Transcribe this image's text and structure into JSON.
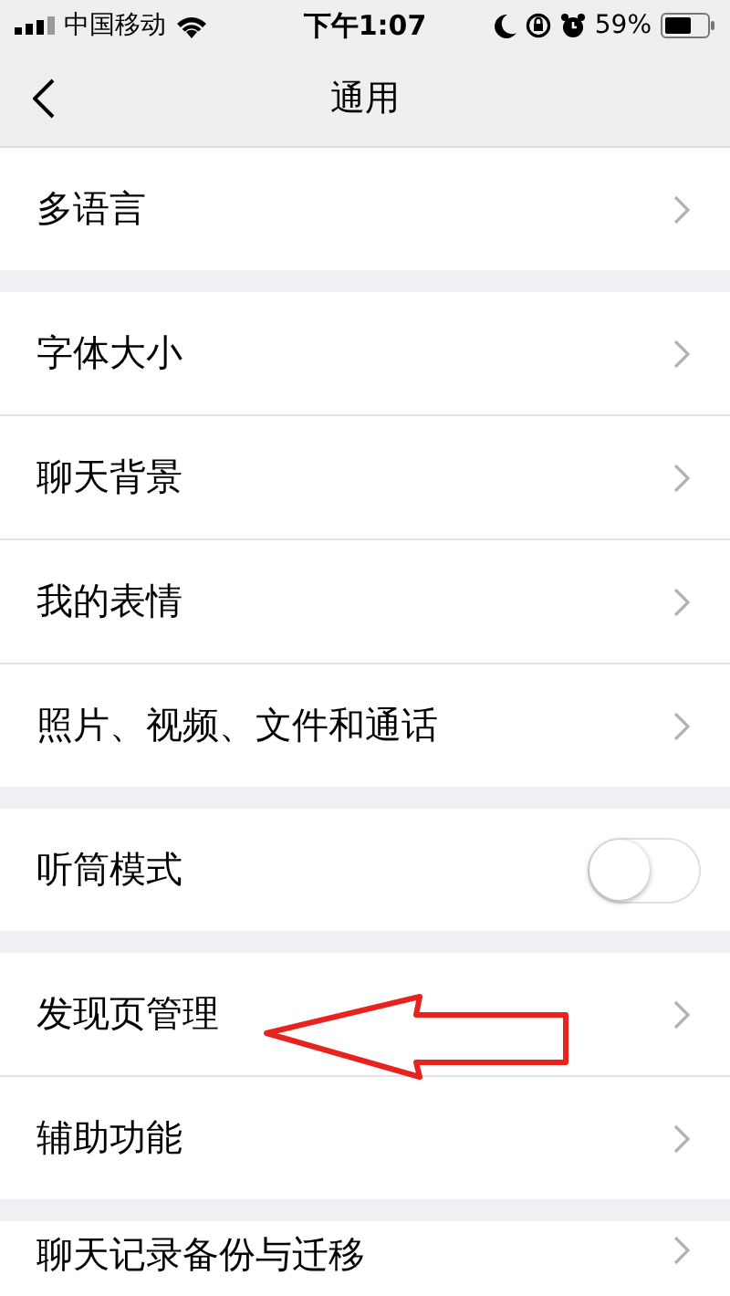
{
  "status_bar": {
    "carrier": "中国移动",
    "time": "下午1:07",
    "battery": "59%"
  },
  "nav": {
    "title": "通用"
  },
  "sections": [
    {
      "rows": [
        {
          "kind": "link",
          "label": "多语言"
        }
      ]
    },
    {
      "rows": [
        {
          "kind": "link",
          "label": "字体大小"
        },
        {
          "kind": "link",
          "label": "聊天背景"
        },
        {
          "kind": "link",
          "label": "我的表情"
        },
        {
          "kind": "link",
          "label": "照片、视频、文件和通话"
        }
      ]
    },
    {
      "rows": [
        {
          "kind": "toggle",
          "label": "听筒模式",
          "on": false
        }
      ]
    },
    {
      "rows": [
        {
          "kind": "link",
          "label": "发现页管理"
        },
        {
          "kind": "link",
          "label": "辅助功能"
        }
      ]
    },
    {
      "rows": [
        {
          "kind": "link",
          "label": "聊天记录备份与迁移"
        }
      ]
    }
  ]
}
